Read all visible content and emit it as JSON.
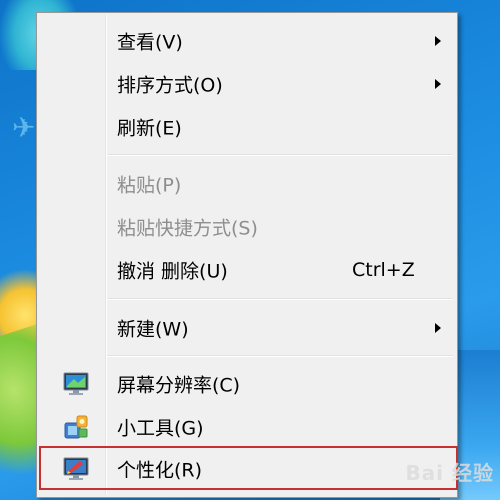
{
  "context_menu": {
    "items": [
      {
        "label": "查看(V)",
        "has_submenu": true
      },
      {
        "label": "排序方式(O)",
        "has_submenu": true
      },
      {
        "label": "刷新(E)"
      },
      {
        "label": "粘贴(P)",
        "disabled": true
      },
      {
        "label": "粘贴快捷方式(S)",
        "disabled": true
      },
      {
        "label": "撤消 删除(U)",
        "shortcut": "Ctrl+Z"
      },
      {
        "label": "新建(W)",
        "has_submenu": true
      },
      {
        "label": "屏幕分辨率(C)",
        "icon": "display-settings-icon"
      },
      {
        "label": "小工具(G)",
        "icon": "gadgets-icon"
      },
      {
        "label": "个性化(R)",
        "icon": "personalize-icon",
        "highlighted": true
      }
    ]
  },
  "colors": {
    "menu_background": "#f0f0f0",
    "disabled_text": "#8e8e8e",
    "highlight_border": "#c8302f"
  },
  "watermark": {
    "text": "Bai 经验"
  }
}
